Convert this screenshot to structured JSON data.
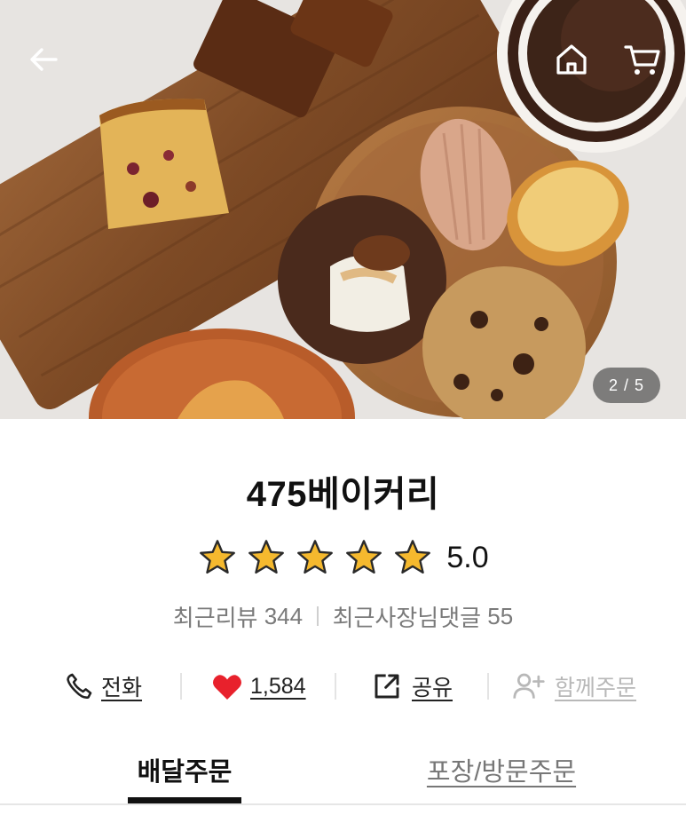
{
  "store": {
    "name": "475베이커리",
    "rating": "5.0",
    "stars": 5,
    "recent_reviews_label": "최근리뷰",
    "recent_reviews_count": "344",
    "owner_replies_label": "최근사장님댓글",
    "owner_replies_count": "55"
  },
  "gallery": {
    "counter": "2 / 5",
    "current": 2,
    "total": 5
  },
  "actions": {
    "call": "전화",
    "likes": "1,584",
    "share": "공유",
    "group_order": "함께주문"
  },
  "tabs": {
    "delivery": "배달주문",
    "pickup": "포장/방문주문"
  },
  "colors": {
    "star": "#F5B92E",
    "heart": "#E8212C",
    "text": "#111111",
    "muted": "#7A7A7A",
    "disabled": "#B8B8B8"
  },
  "icons": [
    "back-arrow-icon",
    "home-icon",
    "cart-icon",
    "star-icon",
    "phone-icon",
    "heart-icon",
    "share-icon",
    "add-person-icon"
  ]
}
